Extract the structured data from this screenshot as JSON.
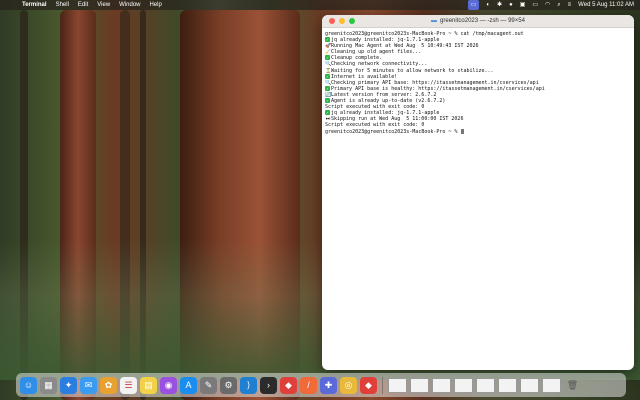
{
  "menubar": {
    "app": "Terminal",
    "items": [
      "Shell",
      "Edit",
      "View",
      "Window",
      "Help"
    ],
    "clock": "Wed 5 Aug  11:02 AM"
  },
  "terminal": {
    "title": "greenitco2023 — -zsh — 99×54",
    "lines": [
      {
        "mark": "",
        "text": "greenitco2023@greenitco2023s-MacBook-Pro ~ % cat /tmp/macagent.out"
      },
      {
        "mark": "check",
        "text": "jq already installed: jq-1.7.1-apple"
      },
      {
        "mark": "🚀",
        "text": "Running Mac Agent at Wed Aug  5 10:49:43 IST 2026"
      },
      {
        "mark": "🧹",
        "text": "Cleaning up old agent files..."
      },
      {
        "mark": "check",
        "text": "Cleanup complete."
      },
      {
        "mark": "🔍",
        "text": "Checking network connectivity..."
      },
      {
        "mark": "⏳",
        "text": "Waiting for 5 minutes to allow network to stabilize..."
      },
      {
        "mark": "check",
        "text": "Internet is available!"
      },
      {
        "mark": "🔍",
        "text": "Checking primary API base: https://itassetmanagement.in/cservices/api"
      },
      {
        "mark": "check",
        "text": "Primary API base is healthy: https://itassetmanagement.in/cservices/api"
      },
      {
        "mark": "🔄",
        "text": "Latest version from server: 2.6.7.2"
      },
      {
        "mark": "check",
        "text": "Agent is already up-to-date (v2.6.7.2)"
      },
      {
        "mark": "",
        "text": "Script executed with exit code: 0"
      },
      {
        "mark": "check",
        "text": "jq already installed: jq-1.7.1-apple"
      },
      {
        "mark": "⏭",
        "text": "Skipping run at Wed Aug  5 11:00:00 IST 2026"
      },
      {
        "mark": "",
        "text": "Script executed with exit code: 0"
      },
      {
        "mark": "",
        "text": "greenitco2023@greenitco2023s-MacBook-Pro ~ % "
      }
    ]
  },
  "dock": {
    "items": [
      {
        "name": "finder",
        "glyph": "☺",
        "color": "#2f8fe8"
      },
      {
        "name": "launchpad",
        "glyph": "▦",
        "color": "#8a8a8a"
      },
      {
        "name": "safari",
        "glyph": "✦",
        "color": "#2a7de1"
      },
      {
        "name": "mail",
        "glyph": "✉",
        "color": "#3b9bf0"
      },
      {
        "name": "photos",
        "glyph": "✿",
        "color": "#e8a030"
      },
      {
        "name": "reminders",
        "glyph": "☰",
        "color": "#f2f2f2"
      },
      {
        "name": "notes",
        "glyph": "▤",
        "color": "#f2d04a"
      },
      {
        "name": "podcasts",
        "glyph": "◉",
        "color": "#9b51e0"
      },
      {
        "name": "app-store",
        "glyph": "A",
        "color": "#1c8df0"
      },
      {
        "name": "script-editor",
        "glyph": "✎",
        "color": "#7a7a7a"
      },
      {
        "name": "system-settings",
        "glyph": "⚙",
        "color": "#6a6a6a"
      },
      {
        "name": "vscode",
        "glyph": "⟩",
        "color": "#1f7fd0"
      },
      {
        "name": "terminal",
        "glyph": "›",
        "color": "#2b2b2b"
      },
      {
        "name": "anydesk",
        "glyph": "◆",
        "color": "#e0403a"
      },
      {
        "name": "pen-app",
        "glyph": "/",
        "color": "#f06a3a"
      },
      {
        "name": "ms-app",
        "glyph": "✚",
        "color": "#5a6ad8"
      },
      {
        "name": "chrome",
        "glyph": "◎",
        "color": "#e8b93a"
      },
      {
        "name": "anydesk-2",
        "glyph": "◆",
        "color": "#e0403a"
      }
    ],
    "trash_glyph": "🗑"
  }
}
